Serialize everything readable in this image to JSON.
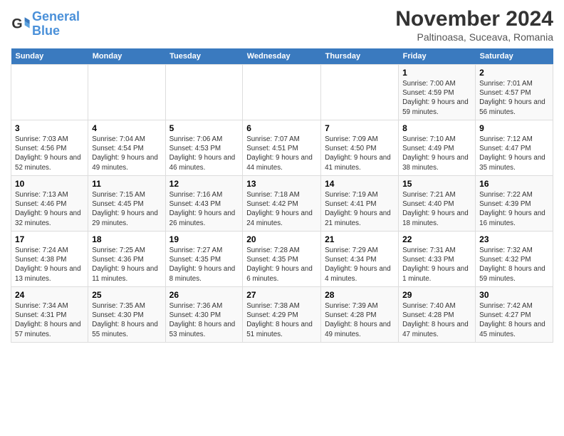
{
  "logo": {
    "text_general": "General",
    "text_blue": "Blue"
  },
  "title": "November 2024",
  "location": "Paltinoasa, Suceava, Romania",
  "headers": [
    "Sunday",
    "Monday",
    "Tuesday",
    "Wednesday",
    "Thursday",
    "Friday",
    "Saturday"
  ],
  "weeks": [
    [
      {
        "day": "",
        "info": ""
      },
      {
        "day": "",
        "info": ""
      },
      {
        "day": "",
        "info": ""
      },
      {
        "day": "",
        "info": ""
      },
      {
        "day": "",
        "info": ""
      },
      {
        "day": "1",
        "info": "Sunrise: 7:00 AM\nSunset: 4:59 PM\nDaylight: 9 hours and 59 minutes."
      },
      {
        "day": "2",
        "info": "Sunrise: 7:01 AM\nSunset: 4:57 PM\nDaylight: 9 hours and 56 minutes."
      }
    ],
    [
      {
        "day": "3",
        "info": "Sunrise: 7:03 AM\nSunset: 4:56 PM\nDaylight: 9 hours and 52 minutes."
      },
      {
        "day": "4",
        "info": "Sunrise: 7:04 AM\nSunset: 4:54 PM\nDaylight: 9 hours and 49 minutes."
      },
      {
        "day": "5",
        "info": "Sunrise: 7:06 AM\nSunset: 4:53 PM\nDaylight: 9 hours and 46 minutes."
      },
      {
        "day": "6",
        "info": "Sunrise: 7:07 AM\nSunset: 4:51 PM\nDaylight: 9 hours and 44 minutes."
      },
      {
        "day": "7",
        "info": "Sunrise: 7:09 AM\nSunset: 4:50 PM\nDaylight: 9 hours and 41 minutes."
      },
      {
        "day": "8",
        "info": "Sunrise: 7:10 AM\nSunset: 4:49 PM\nDaylight: 9 hours and 38 minutes."
      },
      {
        "day": "9",
        "info": "Sunrise: 7:12 AM\nSunset: 4:47 PM\nDaylight: 9 hours and 35 minutes."
      }
    ],
    [
      {
        "day": "10",
        "info": "Sunrise: 7:13 AM\nSunset: 4:46 PM\nDaylight: 9 hours and 32 minutes."
      },
      {
        "day": "11",
        "info": "Sunrise: 7:15 AM\nSunset: 4:45 PM\nDaylight: 9 hours and 29 minutes."
      },
      {
        "day": "12",
        "info": "Sunrise: 7:16 AM\nSunset: 4:43 PM\nDaylight: 9 hours and 26 minutes."
      },
      {
        "day": "13",
        "info": "Sunrise: 7:18 AM\nSunset: 4:42 PM\nDaylight: 9 hours and 24 minutes."
      },
      {
        "day": "14",
        "info": "Sunrise: 7:19 AM\nSunset: 4:41 PM\nDaylight: 9 hours and 21 minutes."
      },
      {
        "day": "15",
        "info": "Sunrise: 7:21 AM\nSunset: 4:40 PM\nDaylight: 9 hours and 18 minutes."
      },
      {
        "day": "16",
        "info": "Sunrise: 7:22 AM\nSunset: 4:39 PM\nDaylight: 9 hours and 16 minutes."
      }
    ],
    [
      {
        "day": "17",
        "info": "Sunrise: 7:24 AM\nSunset: 4:38 PM\nDaylight: 9 hours and 13 minutes."
      },
      {
        "day": "18",
        "info": "Sunrise: 7:25 AM\nSunset: 4:36 PM\nDaylight: 9 hours and 11 minutes."
      },
      {
        "day": "19",
        "info": "Sunrise: 7:27 AM\nSunset: 4:35 PM\nDaylight: 9 hours and 8 minutes."
      },
      {
        "day": "20",
        "info": "Sunrise: 7:28 AM\nSunset: 4:35 PM\nDaylight: 9 hours and 6 minutes."
      },
      {
        "day": "21",
        "info": "Sunrise: 7:29 AM\nSunset: 4:34 PM\nDaylight: 9 hours and 4 minutes."
      },
      {
        "day": "22",
        "info": "Sunrise: 7:31 AM\nSunset: 4:33 PM\nDaylight: 9 hours and 1 minute."
      },
      {
        "day": "23",
        "info": "Sunrise: 7:32 AM\nSunset: 4:32 PM\nDaylight: 8 hours and 59 minutes."
      }
    ],
    [
      {
        "day": "24",
        "info": "Sunrise: 7:34 AM\nSunset: 4:31 PM\nDaylight: 8 hours and 57 minutes."
      },
      {
        "day": "25",
        "info": "Sunrise: 7:35 AM\nSunset: 4:30 PM\nDaylight: 8 hours and 55 minutes."
      },
      {
        "day": "26",
        "info": "Sunrise: 7:36 AM\nSunset: 4:30 PM\nDaylight: 8 hours and 53 minutes."
      },
      {
        "day": "27",
        "info": "Sunrise: 7:38 AM\nSunset: 4:29 PM\nDaylight: 8 hours and 51 minutes."
      },
      {
        "day": "28",
        "info": "Sunrise: 7:39 AM\nSunset: 4:28 PM\nDaylight: 8 hours and 49 minutes."
      },
      {
        "day": "29",
        "info": "Sunrise: 7:40 AM\nSunset: 4:28 PM\nDaylight: 8 hours and 47 minutes."
      },
      {
        "day": "30",
        "info": "Sunrise: 7:42 AM\nSunset: 4:27 PM\nDaylight: 8 hours and 45 minutes."
      }
    ]
  ]
}
